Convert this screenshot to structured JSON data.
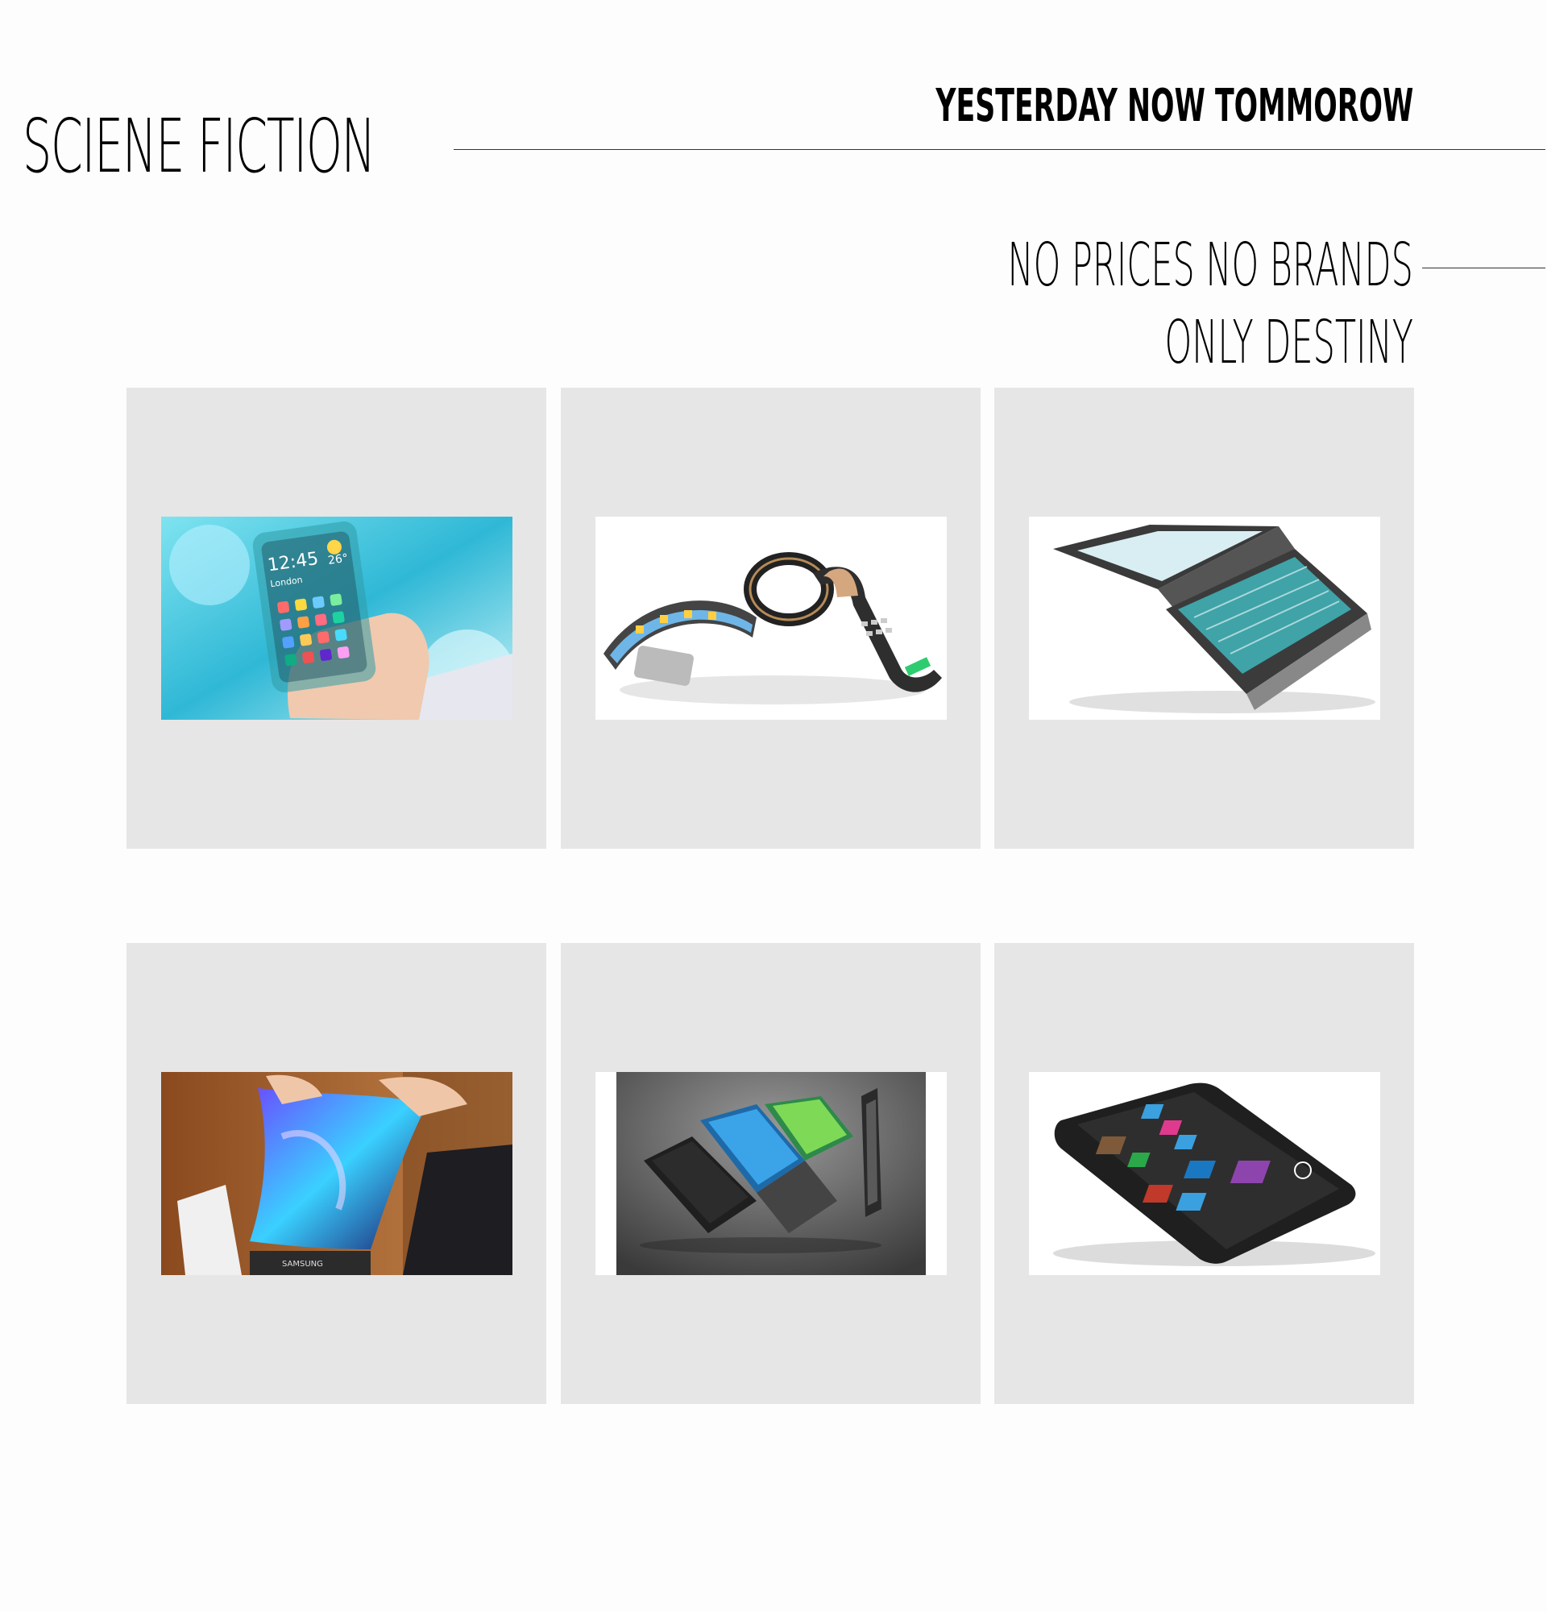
{
  "header": {
    "title": "SCIENE FICTION",
    "tagline": "YESTERDAY NOW TOMMOROW",
    "slogan_line_1": "NO PRICES NO BRANDS",
    "slogan_line_2": "ONLY DESTINY"
  },
  "gallery": {
    "items": [
      {
        "image": "transparent-phone-in-hand",
        "screen_time": "12:45",
        "screen_temp": "26°",
        "screen_city": "London"
      },
      {
        "image": "flexible-wrist-phones"
      },
      {
        "image": "sliding-dual-screen-phone"
      },
      {
        "image": "bending-oled-display",
        "brand_text": "SAMSUNG"
      },
      {
        "image": "modular-concept-phones"
      },
      {
        "image": "windows-tile-phone"
      }
    ]
  }
}
